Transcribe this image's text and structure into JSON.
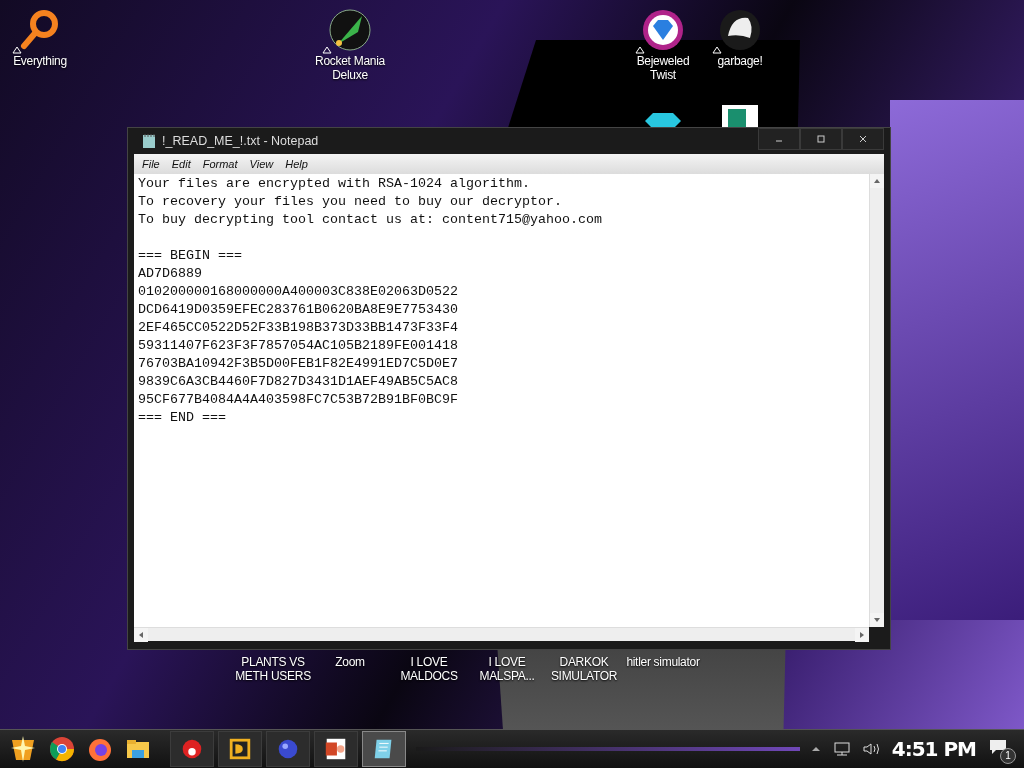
{
  "desktop_icons": [
    {
      "label": "Everything",
      "kind": "search"
    },
    {
      "label": "Rocket Mania\nDeluxe",
      "kind": "rocket"
    },
    {
      "label": "Bejeweled\nTwist",
      "kind": "gem"
    },
    {
      "label": "garbage!",
      "kind": "beast"
    },
    {
      "kind": "diamond"
    },
    {
      "kind": "document"
    }
  ],
  "desktop_labels_lower": [
    "PLANTS VS\nMETH USERS",
    "Zoom",
    "I LOVE\nMALDOCS",
    "I LOVE\nMALSPA...",
    "DARKOK\nSIMULATOR",
    "hitler simulator"
  ],
  "window": {
    "title": "!_READ_ME_!.txt - Notepad",
    "menu": [
      "File",
      "Edit",
      "Format",
      "View",
      "Help"
    ],
    "message": [
      "Your files are encrypted with RSA-1024 algorithm.",
      "To recovery your files you need to buy our decryptor.",
      "To buy decrypting tool contact us at: content715@yahoo.com"
    ],
    "key_block": [
      "=== BEGIN ===",
      "AD7D6889",
      "010200000168000000A400003C838E02063D0522",
      "DCD6419D0359EFEC283761B0620BA8E9E7753430",
      "2EF465CC0522D52F33B198B373D33BB1473F33F4",
      "59311407F623F3F7857054AC105B2189FE001418",
      "76703BA10942F3B5D00FEB1F82E4991ED7C5D0E7",
      "9839C6A3CB4460F7D827D3431D1AEF49AB5C5AC8",
      "95CF677B4084A4A403598FC7C53B72B91BF0BC9F",
      "=== END ==="
    ]
  },
  "taskbar": {
    "pinned": [
      {
        "kind": "chrome"
      },
      {
        "kind": "firefox"
      },
      {
        "kind": "folder"
      }
    ],
    "apps": [
      {
        "kind": "red",
        "selected": false
      },
      {
        "kind": "de",
        "selected": false
      },
      {
        "kind": "ball",
        "selected": false
      },
      {
        "kind": "ppt",
        "selected": false
      },
      {
        "kind": "notepad",
        "selected": true
      }
    ],
    "clock": "4:51 PM",
    "notification_count": "1"
  }
}
